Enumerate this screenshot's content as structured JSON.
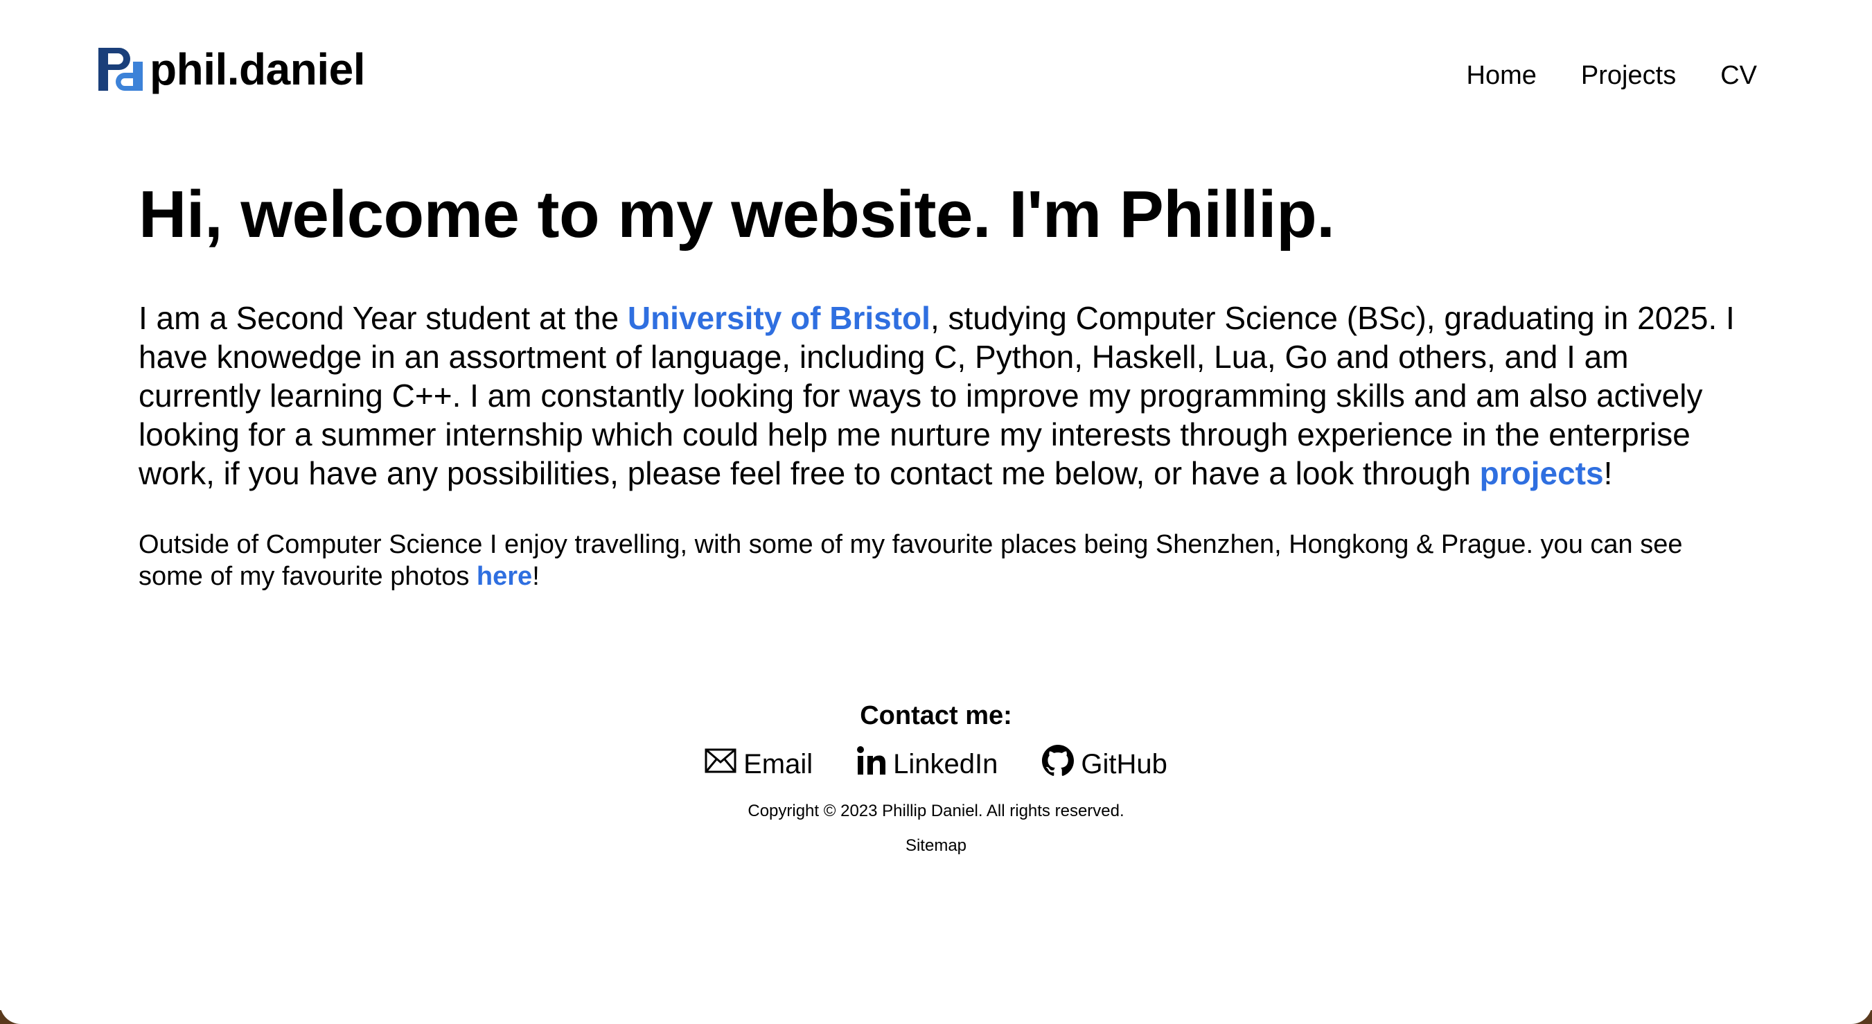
{
  "brand": {
    "name": "phil.daniel",
    "mark_colors": {
      "dark": "#1a3f7a",
      "light": "#3c82d8"
    }
  },
  "nav": {
    "items": [
      {
        "label": "Home"
      },
      {
        "label": "Projects"
      },
      {
        "label": "CV"
      }
    ]
  },
  "main": {
    "title": "Hi, welcome to my website. I'm Phillip.",
    "intro": {
      "part1": "I am a Second Year student at the ",
      "university_link": "University of Bristol",
      "part2": ", studying Computer Science (BSc), graduating in 2025. I have knowedge in an assortment of language, including C, Python, Haskell, Lua, Go and others, and I am currently learning C++. I am constantly looking for ways to improve my programming skills and am also actively looking for a summer internship which could help me nurture my interests through experience in the enterprise work, if you have any possibilities, please feel free to contact me below, or have a look through ",
      "projects_link": "projects",
      "part3": "!"
    },
    "outside": {
      "part1": "Outside of Computer Science I enjoy travelling, with some of my favourite places being Shenzhen, Hongkong & Prague. you can see some of my favourite photos ",
      "here_link": "here",
      "part2": "!"
    }
  },
  "contact": {
    "title": "Contact me:",
    "links": [
      {
        "label": "Email",
        "icon": "envelope-icon"
      },
      {
        "label": "LinkedIn",
        "icon": "linkedin-icon"
      },
      {
        "label": "GitHub",
        "icon": "github-icon"
      }
    ]
  },
  "footer": {
    "copyright": "Copyright © 2023 Phillip Daniel. All rights reserved.",
    "sitemap": "Sitemap"
  },
  "colors": {
    "link": "#2f6fe0",
    "text": "#000000",
    "background": "#ffffff"
  }
}
